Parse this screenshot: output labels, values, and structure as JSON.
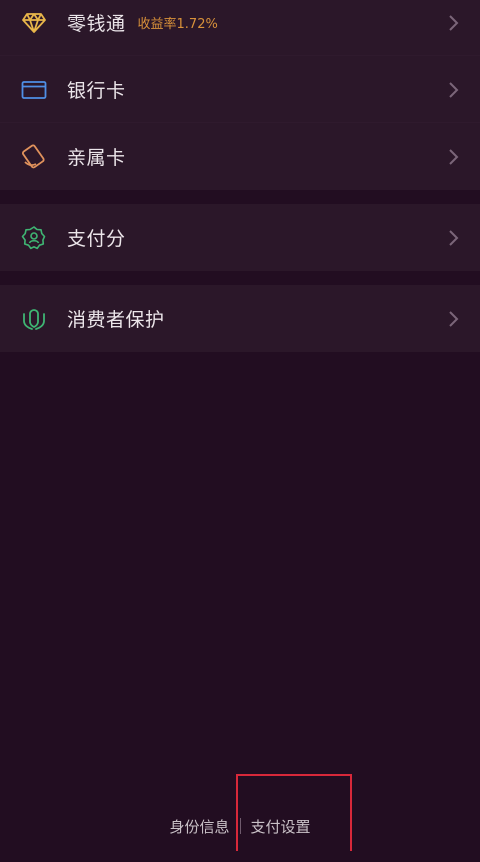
{
  "menu": {
    "group1": [
      {
        "name": "wallet-change",
        "label": "零钱通",
        "sub": "收益率1.72%",
        "icon": "diamond-icon",
        "icon_color": "#e8b64a"
      },
      {
        "name": "bank-card",
        "label": "银行卡",
        "sub": "",
        "icon": "card-icon",
        "icon_color": "#4f8fe6"
      },
      {
        "name": "family-card",
        "label": "亲属卡",
        "sub": "",
        "icon": "family-card-icon",
        "icon_color": "#e0925c"
      }
    ],
    "group2": [
      {
        "name": "pay-score",
        "label": "支付分",
        "sub": "",
        "icon": "badge-icon",
        "icon_color": "#3fb573"
      }
    ],
    "group3": [
      {
        "name": "consumer-protection",
        "label": "消费者保护",
        "sub": "",
        "icon": "shield-hands-icon",
        "icon_color": "#3fb573"
      }
    ]
  },
  "footer": {
    "identity_label": "身份信息",
    "pay_settings_label": "支付设置"
  },
  "colors": {
    "background": "#220d21",
    "card": "#2b1729",
    "accent_yield": "#d8913a",
    "highlight": "#d8283a"
  }
}
